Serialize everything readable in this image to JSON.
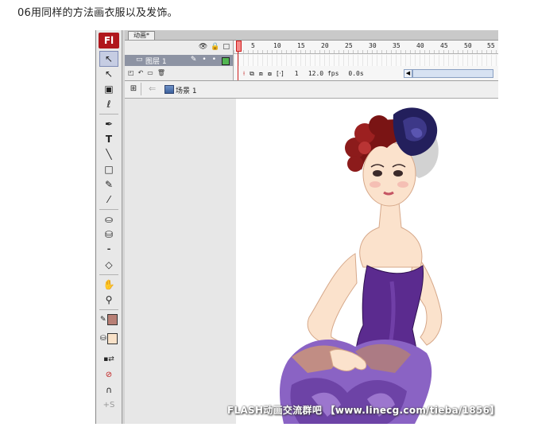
{
  "caption": "06用同样的方法画衣服以及发饰。",
  "app": {
    "logo": "Fl",
    "document_tab": "动画*",
    "colors": {
      "stroke_swatch": "#b87f75",
      "fill_swatch": "#f8e1c8",
      "layer_color": "#51b651"
    },
    "tools": [
      {
        "icon": "selection-arrow-icon",
        "glyph": "↖"
      },
      {
        "icon": "subselection-arrow-icon",
        "glyph": "↖"
      },
      {
        "icon": "free-transform-icon",
        "glyph": "▣"
      },
      {
        "icon": "lasso-icon",
        "glyph": "ℓ"
      },
      {
        "icon": "pen-icon",
        "glyph": "✒"
      },
      {
        "icon": "text-icon",
        "glyph": "T"
      },
      {
        "icon": "line-icon",
        "glyph": "╲"
      },
      {
        "icon": "rectangle-icon",
        "glyph": "□"
      },
      {
        "icon": "pencil-icon",
        "glyph": "✎"
      },
      {
        "icon": "brush-icon",
        "glyph": "⁄"
      },
      {
        "icon": "ink-bottle-icon",
        "glyph": "⛀"
      },
      {
        "icon": "paint-bucket-icon",
        "glyph": "⛁"
      },
      {
        "icon": "eyedropper-icon",
        "glyph": "⁃"
      },
      {
        "icon": "eraser-icon",
        "glyph": "◇"
      },
      {
        "icon": "hand-icon",
        "glyph": "✋"
      },
      {
        "icon": "zoom-icon",
        "glyph": "⚲"
      }
    ],
    "timeline": {
      "header_icons": [
        "eye-icon",
        "lock-icon",
        "outline-icon"
      ],
      "layer_name": "图层 1",
      "frame_numbers": [
        "1",
        "5",
        "10",
        "15",
        "20",
        "25",
        "30",
        "35",
        "40",
        "45",
        "50",
        "55"
      ],
      "current_frame": "1",
      "frame_rate": "12.0 fps",
      "elapsed_time": "0.0s"
    },
    "edit_bar": {
      "scene": "场景 1"
    }
  },
  "watermark": "FLASH动画交流群吧 【www.linecg.com/tieba/1856】"
}
